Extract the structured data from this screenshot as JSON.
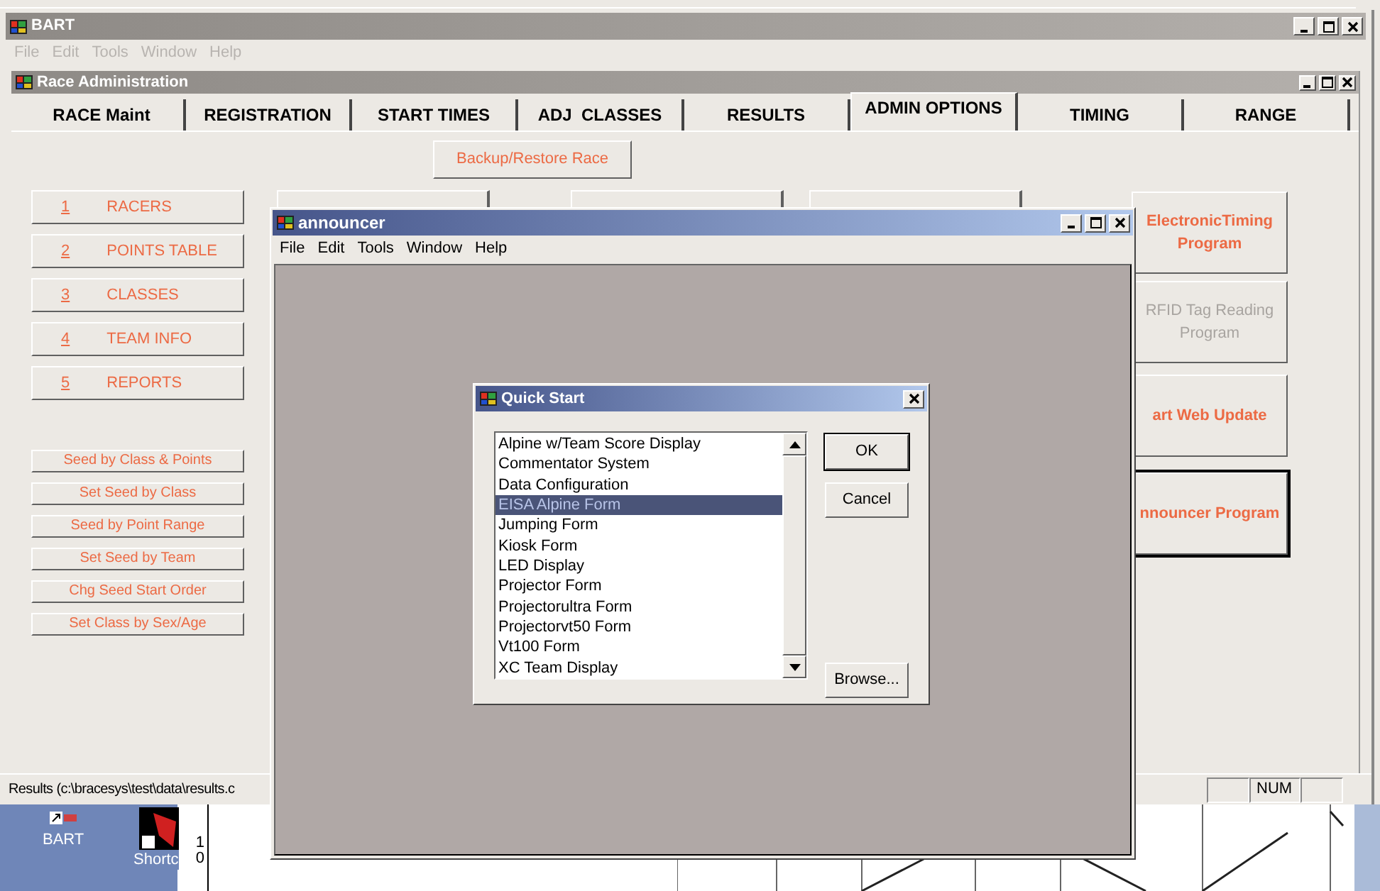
{
  "bart_window": {
    "title": "BART",
    "menu": [
      {
        "label": "File",
        "disabled": true
      },
      {
        "label": "Edit",
        "disabled": true
      },
      {
        "label": "Tools",
        "disabled": true
      },
      {
        "label": "Window",
        "disabled": true
      },
      {
        "label": "Help",
        "disabled": true
      }
    ]
  },
  "race_admin": {
    "title": "Race Administration",
    "tabs": [
      {
        "label": "RACE Maint",
        "selected": false
      },
      {
        "label": "REGISTRATION",
        "selected": false
      },
      {
        "label": "START TIMES",
        "selected": false
      },
      {
        "label": "ADJ  CLASSES",
        "selected": false
      },
      {
        "label": "RESULTS",
        "selected": false
      },
      {
        "label": "ADMIN OPTIONS",
        "selected": true
      },
      {
        "label": "TIMING",
        "selected": false
      },
      {
        "label": "RANGE",
        "selected": false
      }
    ],
    "backup_button": "Backup/Restore Race",
    "main_buttons": [
      {
        "number": "1",
        "label": "RACERS"
      },
      {
        "number": "2",
        "label": "POINTS TABLE"
      },
      {
        "number": "3",
        "label": "CLASSES"
      },
      {
        "number": "4",
        "label": "TEAM INFO"
      },
      {
        "number": "5",
        "label": "REPORTS"
      }
    ],
    "seed_buttons": [
      "Seed by Class & Points",
      "Set Seed by Class",
      "Seed by Point Range",
      "Set Seed by Team",
      "Chg Seed Start Order",
      "Set Class by Sex/Age"
    ],
    "program_buttons": [
      {
        "label": "ElectronicTiming Program",
        "disabled": false,
        "focused": false
      },
      {
        "label": "RFID Tag Reading Program",
        "disabled": true,
        "focused": false
      },
      {
        "label": "art Web Update",
        "disabled": false,
        "focused": false
      },
      {
        "label": "nnouncer Program",
        "disabled": false,
        "focused": true
      }
    ]
  },
  "status_bar": {
    "text": "Results (c:\\bracesys\\test\\data\\results.c",
    "num": "NUM"
  },
  "announcer_window": {
    "title": "announcer",
    "menu": [
      "File",
      "Edit",
      "Tools",
      "Window",
      "Help"
    ]
  },
  "quick_start": {
    "title": "Quick Start",
    "items": [
      {
        "label": "Alpine w/Team Score Display",
        "selected": false
      },
      {
        "label": "Commentator System",
        "selected": false
      },
      {
        "label": "Data Configuration",
        "selected": false
      },
      {
        "label": "EISA Alpine Form",
        "selected": true
      },
      {
        "label": "Jumping Form",
        "selected": false
      },
      {
        "label": "Kiosk Form",
        "selected": false
      },
      {
        "label": "LED Display",
        "selected": false
      },
      {
        "label": "Projector Form",
        "selected": false
      },
      {
        "label": "Projectorultra Form",
        "selected": false
      },
      {
        "label": "Projectorvt50 Form",
        "selected": false
      },
      {
        "label": "Vt100 Form",
        "selected": false
      },
      {
        "label": "XC Team Display",
        "selected": false
      }
    ],
    "buttons": [
      {
        "label": "OK",
        "default": true
      },
      {
        "label": "Cancel",
        "default": false
      },
      {
        "label": "Browse...",
        "default": false
      }
    ]
  },
  "desktop": {
    "icons": [
      {
        "label": "BART"
      },
      {
        "label": "Shortc"
      }
    ],
    "ruler_labels": [
      "1",
      "0"
    ]
  }
}
